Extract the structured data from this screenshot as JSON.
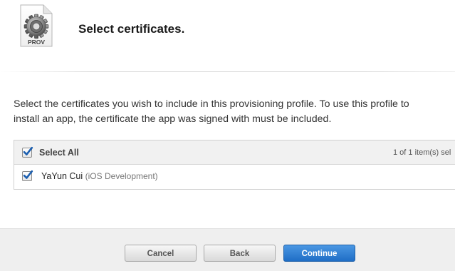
{
  "header": {
    "icon_name": "provisioning-profile-icon",
    "icon_caption": "PROV",
    "title": "Select certificates."
  },
  "description": {
    "line1": "Select the certificates you wish to include in this provisioning profile. To use this profile to",
    "line2": "install an app, the certificate the app was signed with must be included."
  },
  "table": {
    "select_all_label": "Select All",
    "select_all_checked": true,
    "count_label": "1 of 1 item(s) sel",
    "rows": [
      {
        "name": "YaYun Cui",
        "type": "(iOS Development)",
        "checked": true
      }
    ]
  },
  "footer": {
    "cancel_label": "Cancel",
    "back_label": "Back",
    "continue_label": "Continue"
  },
  "colors": {
    "primary_button": "#2a7ad3",
    "checkmark": "#1c5fb0",
    "footer_background": "#efefef"
  }
}
